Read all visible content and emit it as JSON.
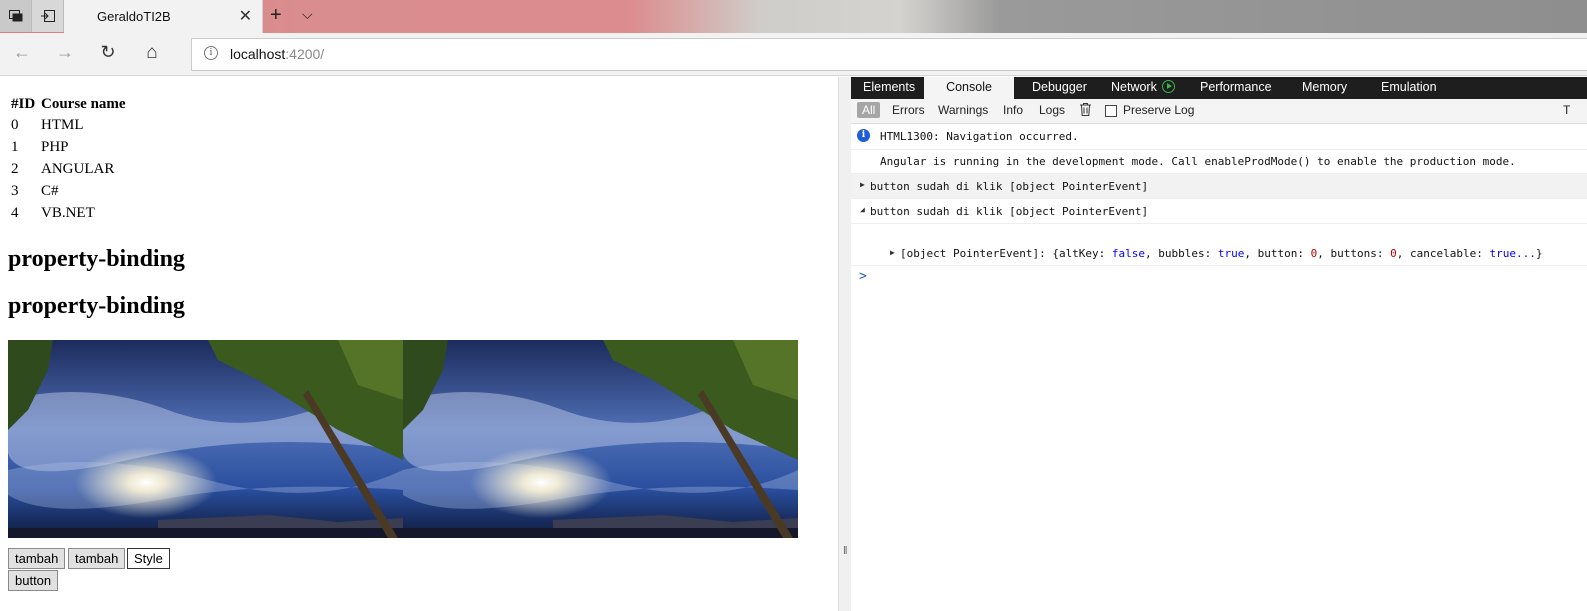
{
  "browser": {
    "tab_title": "GeraldoTI2B",
    "tab_close": "✕",
    "new_tab": "+",
    "tab_menu": "⌵",
    "address_host": "localhost",
    "address_port": ":4200/",
    "nav": {
      "back": "←",
      "forward": "→",
      "refresh": "↻",
      "home": "⌂"
    }
  },
  "page": {
    "table_header": {
      "id": "#ID",
      "name": "Course name"
    },
    "courses": [
      {
        "id": "0",
        "name": "HTML"
      },
      {
        "id": "1",
        "name": "PHP"
      },
      {
        "id": "2",
        "name": "ANGULAR"
      },
      {
        "id": "3",
        "name": "C#"
      },
      {
        "id": "4",
        "name": "VB.NET"
      }
    ],
    "heading_1": "property-binding",
    "heading_2": "property-binding",
    "buttons": {
      "tambah_1": "tambah",
      "tambah_2": "tambah",
      "style": "Style",
      "button": "button"
    }
  },
  "devtools": {
    "tabs": [
      "Elements",
      "Console",
      "Debugger",
      "Network",
      "Performance",
      "Memory",
      "Emulation"
    ],
    "active_tab": "Console",
    "filters": [
      "All",
      "Errors",
      "Warnings",
      "Info",
      "Logs"
    ],
    "preserve_log": "Preserve Log",
    "cut_label": "T",
    "console": {
      "nav_msg": "HTML1300: Navigation occurred.",
      "angular_msg": "Angular is running in the development mode. Call enableProdMode() to enable the production mode.",
      "click_msg_1": "button sudah di klik [object PointerEvent]",
      "click_msg_2": "button sudah di klik [object PointerEvent]",
      "obj_prefix": "[object PointerEvent]: {altKey: ",
      "v_false": "false",
      "sep_bubbles": ", bubbles: ",
      "v_true_1": "true",
      "sep_button": ", button: ",
      "v_zero_1": "0",
      "sep_buttons": ", buttons: ",
      "v_zero_2": "0",
      "sep_cancelable": ", cancelable: ",
      "v_true_2": "true...",
      "obj_suffix": "}",
      "prompt": ">"
    }
  }
}
